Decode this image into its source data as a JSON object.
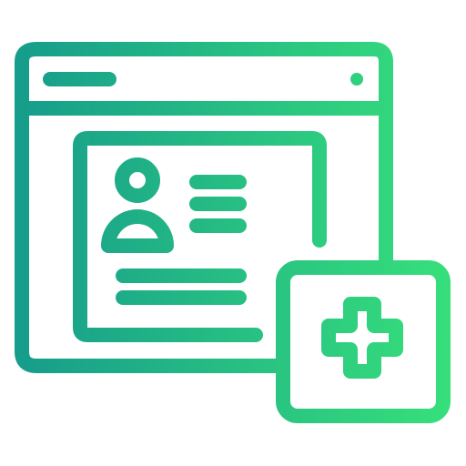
{
  "icon": {
    "semantic": "online-medical-record-icon",
    "parts": [
      "browser-window-icon",
      "patient-profile-card-icon",
      "user-avatar-icon",
      "medical-cross-icon"
    ]
  },
  "colors": {
    "gradient_start": "#159a8c",
    "gradient_end": "#38e27a",
    "background": "#ffffff"
  }
}
